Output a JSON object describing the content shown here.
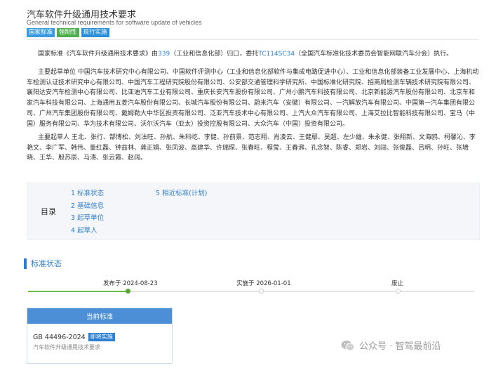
{
  "header": {
    "title_cn": "汽车软件升级通用技术要求",
    "title_en": "General technical requirements for software update of vehicles",
    "badges": [
      "国家标准",
      "强制性",
      "现行实施"
    ]
  },
  "info": {
    "p1_a": "国家标准《汽车软件升级通用技术要求》由",
    "p1_link1": "339",
    "p1_b": "（工业和信息化部）归口，委托",
    "p1_link2": "TC114SC34",
    "p1_c": "（全国汽车标准化技术委员会智能网联汽车分会）执行。",
    "drafting_units": "主要起草单位 中国汽车技术研究中心有限公司、中国软件评测中心（工业和信息化部软件与集成电路促进中心）、工业和信息化部装备工业发展中心、上海机动车检测认证技术研究中心有限公司、中国汽车工程研究院股份有限公司、公安部交通管理科学研究所、中国标准化研究院、招商局检测车辆技术研究院有限公司、襄阳达安汽车检测中心有限公司、比亚迪汽车工业有限公司、重庆长安汽车股份有限公司、广州小鹏汽车科技有限公司、北京新能源汽车股份有限公司、北京车和家汽车科技有限公司、上海通用五菱汽车股份有限公司、长城汽车股份有限公司、蔚来汽车（安徽）有限公司、一汽解放汽车有限公司、中国第一汽车集团有限公司、广州汽车集团股份有限公司、戴姆勒大中华区投资有限公司、泛亚汽车技术中心有限公司、上汽大众汽车有限公司、上海艾拉比智能科技有限公司、宝马（中国）服务有限公司、华为技术有限公司、沃尔沃汽车（亚太）投资控股有限公司、大众汽车（中国）投资有限公司。",
    "drafters": "主要起草人 王北、张行、郜博松、刘法旺、孙航、朱科屹、李健、孙前景、范志翔、肖凌云、王健鄢、吴超、左少雄、朱永健、张翔新、文海鸥、柯馨沁、李艳文、李广军、韩伟、董红磊、钟益林、龚正娟、张凤波、高建华、许瑞琛、张春旺、程莹、王春湃、孔念智、陈睿、郑岩、刘阔、张俊磊、吕明、孙旺、张墙晓、王华、殷苏辰、马涛、张云霞、赵阔。"
  },
  "toc": {
    "label": "目录",
    "items": [
      "1  标准状态",
      "2  基础信息",
      "3  起草单位",
      "4  起草人"
    ],
    "items_right": [
      "5  相近标准(计划)"
    ]
  },
  "status_section": {
    "title": "标准状态",
    "timeline": [
      {
        "label": "发布于 2024-08-23",
        "done": true
      },
      {
        "label": "实施于 2026-01-01",
        "done": false
      },
      {
        "label": "废止",
        "done": false
      }
    ]
  },
  "current_card": {
    "header": "当前标准",
    "code": "GB 44496-2024",
    "badge": "即将实施",
    "subtitle": "汽车软件升级通用技术要求"
  },
  "watermark": {
    "text": "公众号 · 智驾最前沿"
  },
  "colors": {
    "accent_blue": "#2f7fc8",
    "badge_green": "#4cae4c",
    "timeline_green": "#5ba538",
    "card_header": "#4c8fd6"
  }
}
